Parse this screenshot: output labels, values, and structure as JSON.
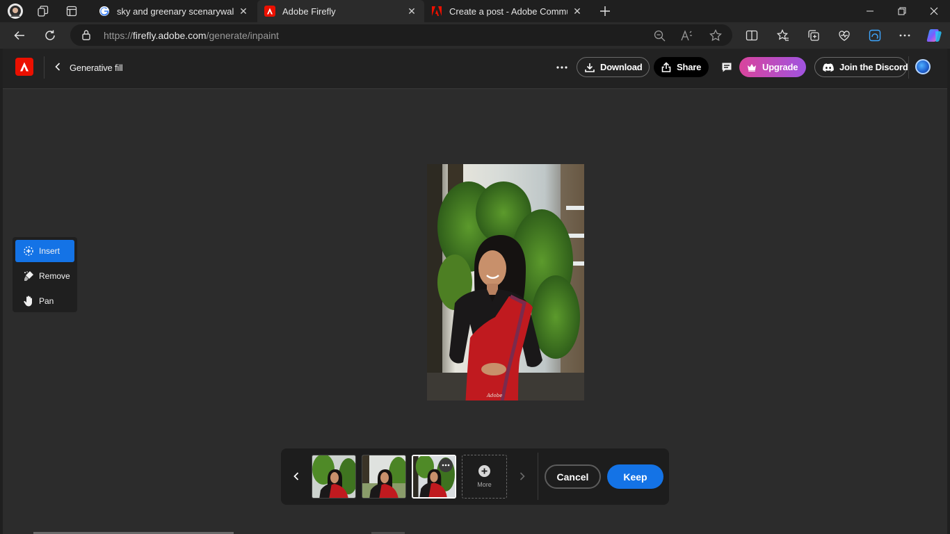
{
  "browser": {
    "tabs": [
      {
        "title": "sky and greenary scenarywallpap",
        "favicon": "google-icon",
        "active": false
      },
      {
        "title": "Adobe Firefly",
        "favicon": "adobe-icon",
        "active": true
      },
      {
        "title": "Create a post - Adobe Communi",
        "favicon": "adobe-icon",
        "active": false
      }
    ],
    "url_prefix": "https://",
    "url_domain": "firefly.adobe.com",
    "url_path": "/generate/inpaint"
  },
  "header": {
    "title": "Generative fill",
    "download_label": "Download",
    "share_label": "Share",
    "upgrade_label": "Upgrade",
    "discord_label": "Join the Discord"
  },
  "tools": [
    {
      "label": "Insert",
      "icon": "insert-brush-icon",
      "active": true
    },
    {
      "label": "Remove",
      "icon": "remove-brush-icon",
      "active": false
    },
    {
      "label": "Pan",
      "icon": "hand-icon",
      "active": false
    }
  ],
  "variations": {
    "more_label": "More",
    "selected_index": 2,
    "count": 3
  },
  "actions": {
    "cancel_label": "Cancel",
    "keep_label": "Keep"
  },
  "colors": {
    "accent": "#1473e6",
    "brand": "#eb1000",
    "upgrade_gradient_start": "#d9449c",
    "upgrade_gradient_end": "#a054e0"
  }
}
